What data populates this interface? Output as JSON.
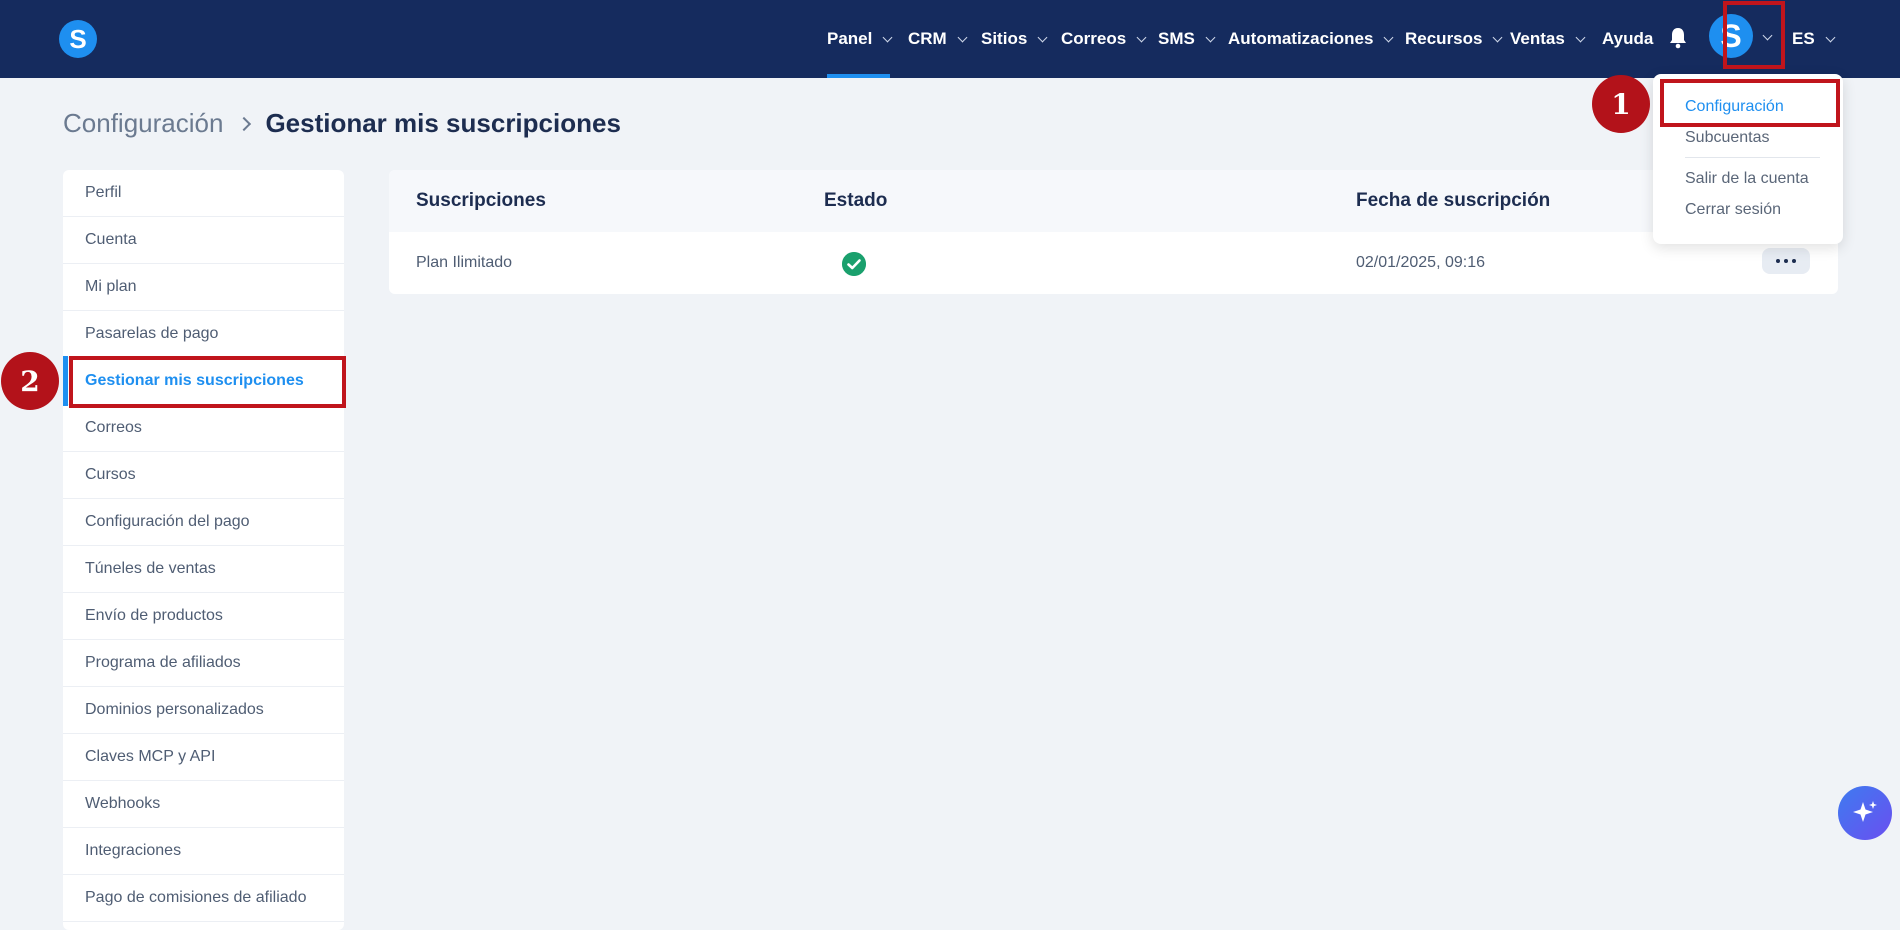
{
  "brand": {
    "logo_letter": "S",
    "accent": "#1e8ff0",
    "topbar_color": "#152b5e",
    "marker_color": "#b3121a"
  },
  "nav": {
    "items": [
      {
        "label": "Panel",
        "has_dropdown": true,
        "active": true
      },
      {
        "label": "CRM",
        "has_dropdown": true
      },
      {
        "label": "Sitios",
        "has_dropdown": true
      },
      {
        "label": "Correos",
        "has_dropdown": true
      },
      {
        "label": "SMS",
        "has_dropdown": true
      },
      {
        "label": "Automatizaciones",
        "has_dropdown": true
      },
      {
        "label": "Recursos",
        "has_dropdown": true
      },
      {
        "label": "Ventas",
        "has_dropdown": true
      },
      {
        "label": "Ayuda",
        "has_dropdown": false
      }
    ],
    "avatar_letter": "S",
    "language": "ES"
  },
  "breadcrumb": {
    "root": "Configuración",
    "current": "Gestionar mis suscripciones"
  },
  "sidebar": {
    "items": [
      {
        "label": "Perfil"
      },
      {
        "label": "Cuenta"
      },
      {
        "label": "Mi plan"
      },
      {
        "label": "Pasarelas de pago"
      },
      {
        "label": "Gestionar mis suscripciones",
        "active": true
      },
      {
        "label": "Correos"
      },
      {
        "label": "Cursos"
      },
      {
        "label": "Configuración del pago"
      },
      {
        "label": "Túneles de ventas"
      },
      {
        "label": "Envío de productos"
      },
      {
        "label": "Programa de afiliados"
      },
      {
        "label": "Dominios personalizados"
      },
      {
        "label": "Claves MCP y API"
      },
      {
        "label": "Webhooks"
      },
      {
        "label": "Integraciones"
      },
      {
        "label": "Pago de comisiones de afiliado"
      }
    ]
  },
  "table": {
    "headers": {
      "subscriptions": "Suscripciones",
      "status": "Estado",
      "date": "Fecha de suscripción"
    },
    "rows": [
      {
        "name": "Plan Ilimitado",
        "status_icon": "check-circle-icon",
        "date": "02/01/2025, 09:16"
      }
    ]
  },
  "dropdown": {
    "items": [
      "Configuración",
      "Subcuentas",
      "Salir de la cuenta",
      "Cerrar sesión"
    ]
  },
  "markers": {
    "one": "1",
    "two": "2"
  }
}
